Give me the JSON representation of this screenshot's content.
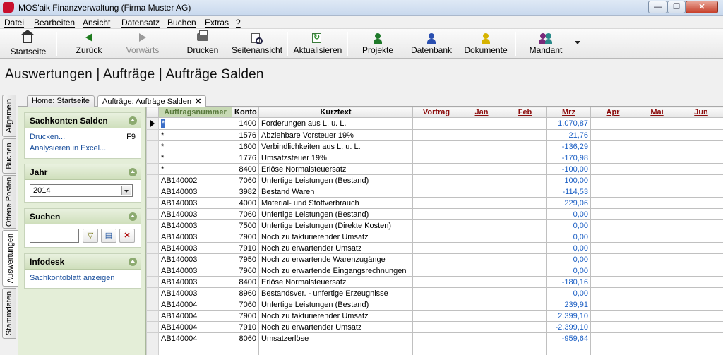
{
  "window": {
    "title": "MOS'aik Finanzverwaltung (Firma Muster AG)",
    "min_label": "—",
    "max_label": "❐",
    "close_label": "✕"
  },
  "menu": [
    "Datei",
    "Bearbeiten",
    "Ansicht",
    "Datensatz",
    "Buchen",
    "Extras",
    "?"
  ],
  "toolbar": {
    "startseite": "Startseite",
    "zurueck": "Zurück",
    "vorwaerts": "Vorwärts",
    "drucken": "Drucken",
    "seitenansicht": "Seitenansicht",
    "aktualisieren": "Aktualisieren",
    "projekte": "Projekte",
    "datenbank": "Datenbank",
    "dokumente": "Dokumente",
    "mandant": "Mandant"
  },
  "page_title": "Auswertungen | Aufträge | Aufträge Salden",
  "side_tabs": [
    "Allgemein",
    "Buchen",
    "Offene Posten",
    "Auswertungen",
    "Stammdaten"
  ],
  "doc_tabs": [
    "Home: Startseite",
    "Aufträge: Aufträge Salden"
  ],
  "doc_tab_close": "✕",
  "sidebar": {
    "sachkonten": {
      "title": "Sachkonten Salden",
      "drucken": "Drucken...",
      "drucken_shortcut": "F9",
      "excel": "Analysieren in Excel..."
    },
    "jahr": {
      "title": "Jahr",
      "value": "2014"
    },
    "suchen": {
      "title": "Suchen",
      "placeholder": ""
    },
    "infodesk": {
      "title": "Infodesk",
      "link": "Sachkontoblatt anzeigen"
    }
  },
  "grid": {
    "columns": [
      "Auftragsnummer",
      "Konto",
      "Kurztext",
      "Vortrag",
      "Jan",
      "Feb",
      "Mrz",
      "Apr",
      "Mai",
      "Jun"
    ],
    "rows": [
      [
        "*",
        "1400",
        "Forderungen aus L. u. L.",
        "",
        "",
        "",
        "1.070,87"
      ],
      [
        "*",
        "1576",
        "Abziehbare Vorsteuer 19%",
        "",
        "",
        "",
        "21,76"
      ],
      [
        "*",
        "1600",
        "Verbindlichkeiten aus L. u. L.",
        "",
        "",
        "",
        "-136,29"
      ],
      [
        "*",
        "1776",
        "Umsatzsteuer 19%",
        "",
        "",
        "",
        "-170,98"
      ],
      [
        "*",
        "8400",
        "Erlöse Normalsteuersatz",
        "",
        "",
        "",
        "-100,00"
      ],
      [
        "AB140002",
        "7060",
        "Unfertige Leistungen (Bestand)",
        "",
        "",
        "",
        "100,00"
      ],
      [
        "AB140003",
        "3982",
        "Bestand Waren",
        "",
        "",
        "",
        "-114,53"
      ],
      [
        "AB140003",
        "4000",
        "Material- und Stoffverbrauch",
        "",
        "",
        "",
        "229,06"
      ],
      [
        "AB140003",
        "7060",
        "Unfertige Leistungen (Bestand)",
        "",
        "",
        "",
        "0,00"
      ],
      [
        "AB140003",
        "7500",
        "Unfertige Leistungen (Direkte Kosten)",
        "",
        "",
        "",
        "0,00"
      ],
      [
        "AB140003",
        "7900",
        "Noch zu fakturierender Umsatz",
        "",
        "",
        "",
        "0,00"
      ],
      [
        "AB140003",
        "7910",
        "Noch zu erwartender Umsatz",
        "",
        "",
        "",
        "0,00"
      ],
      [
        "AB140003",
        "7950",
        "Noch zu erwartende Warenzugänge",
        "",
        "",
        "",
        "0,00"
      ],
      [
        "AB140003",
        "7960",
        "Noch zu erwartende Eingangsrechnungen",
        "",
        "",
        "",
        "0,00"
      ],
      [
        "AB140003",
        "8400",
        "Erlöse Normalsteuersatz",
        "",
        "",
        "",
        "-180,16"
      ],
      [
        "AB140003",
        "8960",
        "Bestandsver. - unfertige Erzeugnisse",
        "",
        "",
        "",
        "0,00"
      ],
      [
        "AB140004",
        "7060",
        "Unfertige Leistungen (Bestand)",
        "",
        "",
        "",
        "239,91"
      ],
      [
        "AB140004",
        "7900",
        "Noch zu fakturierender Umsatz",
        "",
        "",
        "",
        "2.399,10"
      ],
      [
        "AB140004",
        "7910",
        "Noch zu erwartender Umsatz",
        "",
        "",
        "",
        "-2.399,10"
      ],
      [
        "AB140004",
        "8060",
        "Umsatzerlöse",
        "",
        "",
        "",
        "-959,64"
      ],
      [
        "",
        "",
        "",
        "",
        "",
        "",
        ""
      ]
    ]
  },
  "colors": {
    "month_header": "#8b0c0c",
    "value_blue": "#1b5fc4",
    "sidebar_bg": "#e4eed8",
    "sorted_header": "#c7d9b4"
  }
}
